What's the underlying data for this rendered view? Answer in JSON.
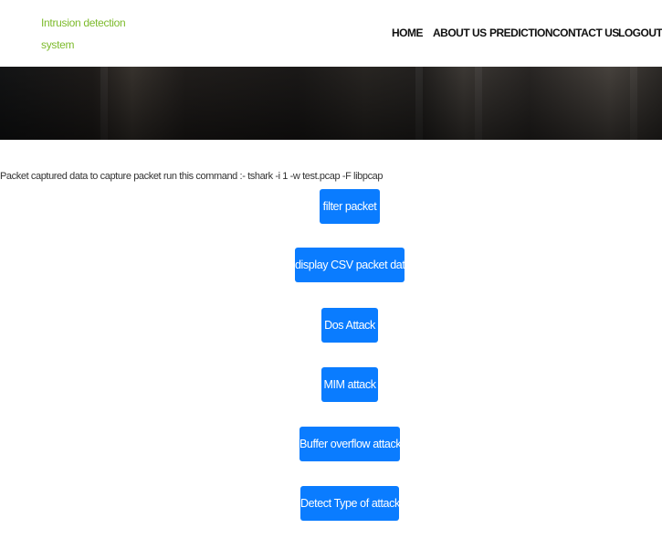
{
  "brand": {
    "line1": "Intrusion detection",
    "line2": "system"
  },
  "nav": [
    "HOME",
    "ABOUT US",
    "PREDICTION",
    "CONTACT US",
    "LOGOUT"
  ],
  "capture_note": "Packet captured data to capture packet run this command :- tshark -i 1 -w test.pcap -F libpcap",
  "actions": [
    "filter packet",
    "display CSV packet data",
    "Dos Attack",
    "MIM attack",
    "Buffer overflow attack",
    "Detect Type of attack"
  ],
  "colors": {
    "brand": "#7dbb2c",
    "button": "#0a7cff",
    "nav_text": "#111111"
  }
}
